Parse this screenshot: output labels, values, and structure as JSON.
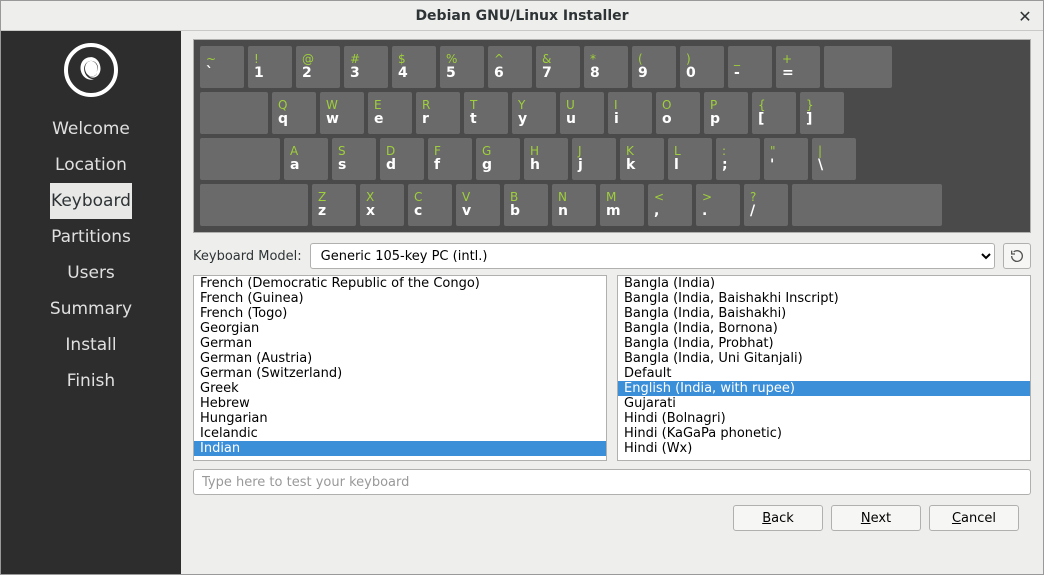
{
  "window": {
    "title": "Debian GNU/Linux Installer"
  },
  "sidebar": {
    "items": [
      {
        "label": "Welcome",
        "active": false
      },
      {
        "label": "Location",
        "active": false
      },
      {
        "label": "Keyboard",
        "active": true
      },
      {
        "label": "Partitions",
        "active": false
      },
      {
        "label": "Users",
        "active": false
      },
      {
        "label": "Summary",
        "active": false
      },
      {
        "label": "Install",
        "active": false
      },
      {
        "label": "Finish",
        "active": false
      }
    ]
  },
  "keyboard": {
    "model_label": "Keyboard Model:",
    "model_value": "Generic 105-key PC (intl.)",
    "rows": [
      [
        {
          "up": "~",
          "lo": "`"
        },
        {
          "up": "!",
          "lo": "1"
        },
        {
          "up": "@",
          "lo": "2"
        },
        {
          "up": "#",
          "lo": "3"
        },
        {
          "up": "$",
          "lo": "4"
        },
        {
          "up": "%",
          "lo": "5"
        },
        {
          "up": "^",
          "lo": "6"
        },
        {
          "up": "&",
          "lo": "7"
        },
        {
          "up": "*",
          "lo": "8"
        },
        {
          "up": "(",
          "lo": "9"
        },
        {
          "up": ")",
          "lo": "0"
        },
        {
          "up": "_",
          "lo": "-"
        },
        {
          "up": "+",
          "lo": "="
        }
      ],
      [
        {
          "up": "Q",
          "lo": "q"
        },
        {
          "up": "W",
          "lo": "w"
        },
        {
          "up": "E",
          "lo": "e"
        },
        {
          "up": "R",
          "lo": "r"
        },
        {
          "up": "T",
          "lo": "t"
        },
        {
          "up": "Y",
          "lo": "y"
        },
        {
          "up": "U",
          "lo": "u"
        },
        {
          "up": "I",
          "lo": "i"
        },
        {
          "up": "O",
          "lo": "o"
        },
        {
          "up": "P",
          "lo": "p"
        },
        {
          "up": "{",
          "lo": "["
        },
        {
          "up": "}",
          "lo": "]"
        }
      ],
      [
        {
          "up": "A",
          "lo": "a"
        },
        {
          "up": "S",
          "lo": "s"
        },
        {
          "up": "D",
          "lo": "d"
        },
        {
          "up": "F",
          "lo": "f"
        },
        {
          "up": "G",
          "lo": "g"
        },
        {
          "up": "H",
          "lo": "h"
        },
        {
          "up": "J",
          "lo": "j"
        },
        {
          "up": "K",
          "lo": "k"
        },
        {
          "up": "L",
          "lo": "l"
        },
        {
          "up": ":",
          "lo": ";"
        },
        {
          "up": "\"",
          "lo": "'"
        },
        {
          "up": "|",
          "lo": "\\"
        }
      ],
      [
        {
          "up": "Z",
          "lo": "z"
        },
        {
          "up": "X",
          "lo": "x"
        },
        {
          "up": "C",
          "lo": "c"
        },
        {
          "up": "V",
          "lo": "v"
        },
        {
          "up": "B",
          "lo": "b"
        },
        {
          "up": "N",
          "lo": "n"
        },
        {
          "up": "M",
          "lo": "m"
        },
        {
          "up": "<",
          "lo": ","
        },
        {
          "up": ">",
          "lo": "."
        },
        {
          "up": "?",
          "lo": "/"
        }
      ]
    ]
  },
  "layout_list": {
    "items": [
      "French (Democratic Republic of the Congo)",
      "French (Guinea)",
      "French (Togo)",
      "Georgian",
      "German",
      "German (Austria)",
      "German (Switzerland)",
      "Greek",
      "Hebrew",
      "Hungarian",
      "Icelandic",
      "Indian"
    ],
    "selected": "Indian"
  },
  "variant_list": {
    "items": [
      "Bangla (India)",
      "Bangla (India, Baishakhi Inscript)",
      "Bangla (India, Baishakhi)",
      "Bangla (India, Bornona)",
      "Bangla (India, Probhat)",
      "Bangla (India, Uni Gitanjali)",
      "Default",
      "English (India, with rupee)",
      "Gujarati",
      "Hindi (Bolnagri)",
      "Hindi (KaGaPa phonetic)",
      "Hindi (Wx)"
    ],
    "selected": "English (India, with rupee)"
  },
  "test_placeholder": "Type here to test your keyboard",
  "buttons": {
    "back": "Back",
    "next": "Next",
    "cancel": "Cancel"
  }
}
